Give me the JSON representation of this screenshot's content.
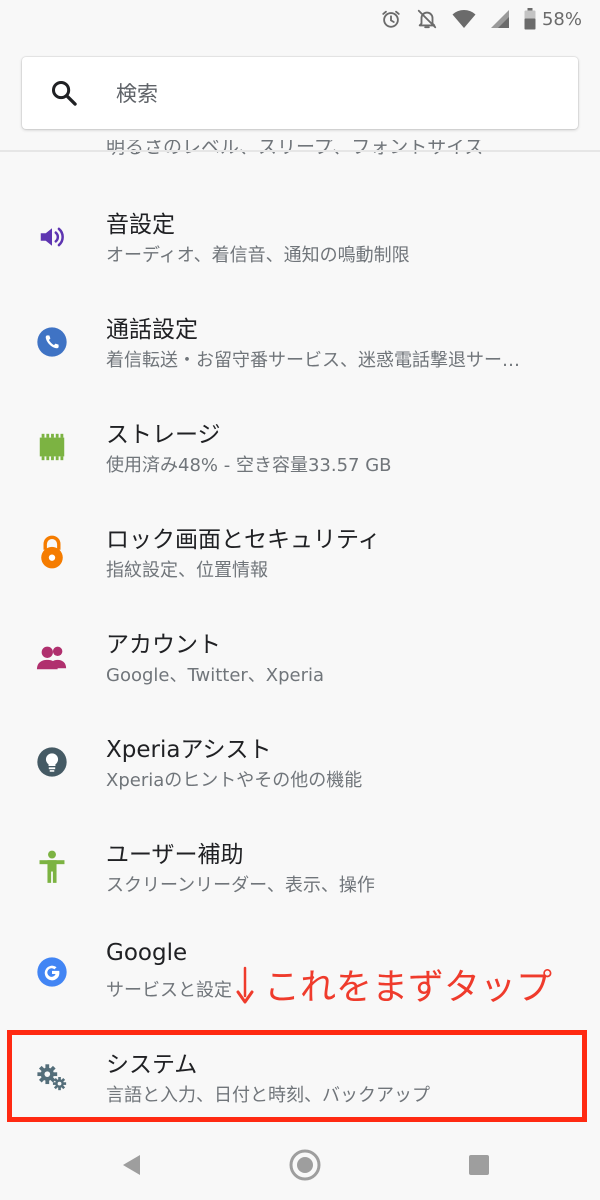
{
  "status_bar": {
    "battery_percent": "58%",
    "icons": [
      "alarm-icon",
      "notifications-off-icon",
      "wifi-icon",
      "signal-icon",
      "battery-icon"
    ]
  },
  "search": {
    "placeholder": "検索"
  },
  "clipped_row": {
    "subtitle": "明るさのレベル、スリープ、フォントサイズ"
  },
  "settings": {
    "items": [
      {
        "title": "音設定",
        "subtitle": "オーディオ、着信音、通知の鳴動制限",
        "icon": "volume-icon",
        "color": "#5e35b1"
      },
      {
        "title": "通話設定",
        "subtitle": "着信転送・お留守番サービス、迷惑電話撃退サー…",
        "icon": "phone-icon",
        "color": "#3f73c4"
      },
      {
        "title": "ストレージ",
        "subtitle": "使用済み48% - 空き容量33.57 GB",
        "icon": "storage-icon",
        "color": "#7cb342"
      },
      {
        "title": "ロック画面とセキュリティ",
        "subtitle": "指紋設定、位置情報",
        "icon": "lock-icon",
        "color": "#f57c00"
      },
      {
        "title": "アカウント",
        "subtitle": "Google、Twitter、Xperia",
        "icon": "accounts-icon",
        "color": "#b0306e"
      },
      {
        "title": "Xperiaアシスト",
        "subtitle": "Xperiaのヒントやその他の機能",
        "icon": "lightbulb-icon",
        "color": "#455a64"
      },
      {
        "title": "ユーザー補助",
        "subtitle": "スクリーンリーダー、表示、操作",
        "icon": "accessibility-icon",
        "color": "#7cb342"
      },
      {
        "title": "Google",
        "subtitle": "サービスと設定",
        "icon": "google-icon",
        "color": "#4285f4"
      },
      {
        "title": "システム",
        "subtitle": "言語と入力、日付と時刻、バックアップ",
        "icon": "gears-icon",
        "color": "#546e7a"
      }
    ]
  },
  "annotation": {
    "text": "これをまずタップ",
    "color": "#ef3b2c",
    "box_color": "#ff2a12"
  },
  "nav_bar": {
    "icons": [
      "back-icon",
      "home-icon",
      "recents-icon"
    ]
  }
}
